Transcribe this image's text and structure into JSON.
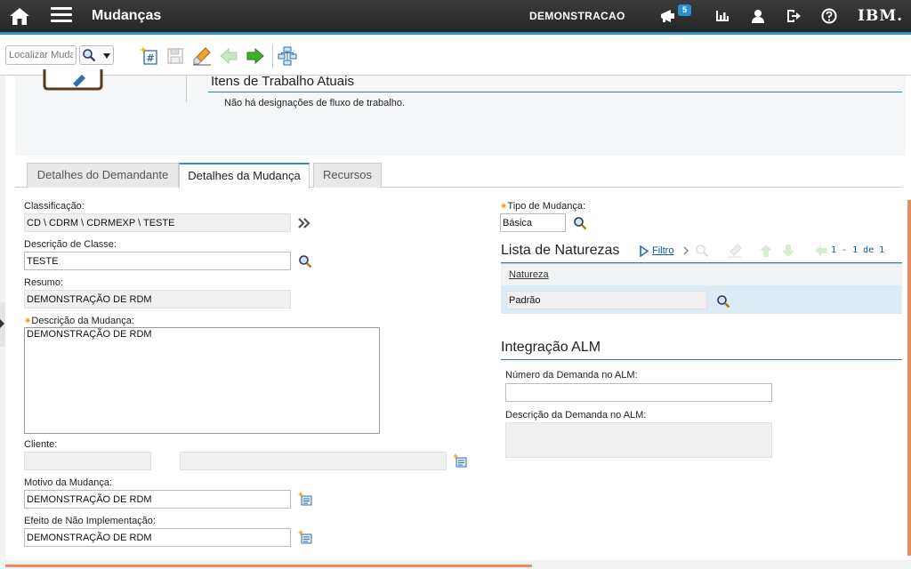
{
  "header": {
    "app_title": "Mudanças",
    "org_name": "DEMONSTRACAO",
    "notifications_count": "5",
    "logo_text": "IBM."
  },
  "toolbar": {
    "find_placeholder": "Localizar Mudança"
  },
  "work_items": {
    "title": "Itens de Trabalho Atuais",
    "message": "Não há designações de fluxo de trabalho."
  },
  "tabs": [
    {
      "label": "Detalhes do Demandante",
      "active": false
    },
    {
      "label": "Detalhes da Mudança",
      "active": true
    },
    {
      "label": "Recursos",
      "active": false
    }
  ],
  "form": {
    "classificacao": {
      "label": "Classificação:",
      "value": "CD \\ CDRM \\ CDRMEXP \\ TESTE"
    },
    "descricao_classe": {
      "label": "Descrição de Classe:",
      "value": "TESTE"
    },
    "resumo": {
      "label": "Resumo:",
      "value": "DEMONSTRAÇÃO DE RDM"
    },
    "descricao_mudanca": {
      "label": "Descrição da Mudança:",
      "value": "DEMONSTRAÇÃO DE RDM",
      "required": true
    },
    "cliente": {
      "label": "Cliente:",
      "value": "",
      "value2": ""
    },
    "motivo": {
      "label": "Motivo da Mudança:",
      "value": "DEMONSTRAÇÃO DE RDM"
    },
    "efeito": {
      "label": "Efeito de Não Implementação:",
      "value": "DEMONSTRAÇÃO DE RDM"
    },
    "tipo_mudanca": {
      "label": "Tipo de Mudança:",
      "value": "Básica",
      "required": true
    }
  },
  "naturezas": {
    "title": "Lista de Naturezas",
    "filter_label": "Filtro",
    "paging": "1 - 1 de 1",
    "column_header": "Natureza",
    "rows": [
      {
        "value": "Padrão"
      }
    ]
  },
  "alm": {
    "title": "Integração ALM",
    "numero": {
      "label": "Número da Demanda no ALM:",
      "value": ""
    },
    "descricao": {
      "label": "Descrição da Demanda no ALM:",
      "value": ""
    }
  },
  "colors": {
    "accent": "#2a8fcf",
    "section_line": "#2d7fa6",
    "selected_row": "#dcecf6",
    "required_marker": "#f0a500"
  }
}
